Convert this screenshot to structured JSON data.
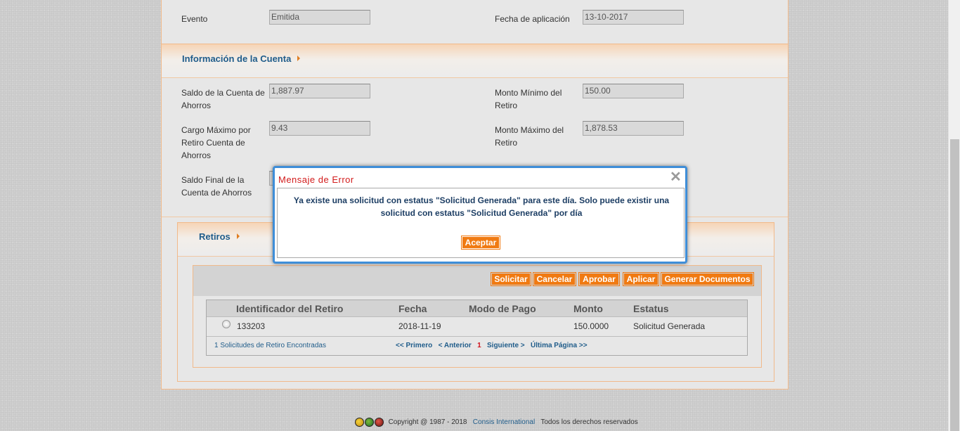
{
  "evento": {
    "label": "Evento",
    "value": "Emitida"
  },
  "fecha_aplicacion": {
    "label": "Fecha de aplicación",
    "value": "13-10-2017"
  },
  "cuenta": {
    "title": "Información de la Cuenta",
    "saldo_label_1": "Saldo de la Cuenta de",
    "saldo_label_2": "Ahorros",
    "saldo_value": "1,887.97",
    "monto_min_label_1": "Monto Mínimo del",
    "monto_min_label_2": "Retiro",
    "monto_min_value": "150.00",
    "cargo_label_1": "Cargo Máximo por",
    "cargo_label_2": "Retiro Cuenta de",
    "cargo_label_3": "Ahorros",
    "cargo_value": "9.43",
    "monto_max_label_1": "Monto Máximo del",
    "monto_max_label_2": "Retiro",
    "monto_max_value": "1,878.53",
    "saldo_final_label_1": "Saldo Final de la",
    "saldo_final_label_2": "Cuenta de Ahorros"
  },
  "retiros": {
    "title": "Retiros",
    "buttons": {
      "solicitar": "Solicitar",
      "cancelar": "Cancelar",
      "aprobar": "Aprobar",
      "aplicar": "Aplicar",
      "generar": "Generar Documentos"
    },
    "columns": {
      "id": "Identificador del Retiro",
      "fecha": "Fecha",
      "modo": "Modo de Pago",
      "monto": "Monto",
      "estatus": "Estatus"
    },
    "rows": [
      {
        "id": "133203",
        "fecha": "2018-11-19",
        "modo": "",
        "monto": "150.0000",
        "estatus": "Solicitud Generada"
      }
    ],
    "found": "1 Solicitudes de Retiro Encontradas",
    "pager": {
      "first": "<< Primero",
      "prev": "< Anterior",
      "current": "1",
      "next": "Siguiente >",
      "last": "Última Página >>"
    }
  },
  "modal": {
    "title": "Mensaje de Error",
    "line1": "Ya existe una solicitud con estatus \"Solicitud Generada\" para este día. Solo puede existir una",
    "line2": "solicitud con estatus \"Solicitud Generada\" por día",
    "ok": "Aceptar",
    "close_icon": "close-icon"
  },
  "footer": {
    "copyright": "Copyright @ 1987 - 2018",
    "company": "Consis International",
    "rights": "Todos los derechos reservados"
  }
}
